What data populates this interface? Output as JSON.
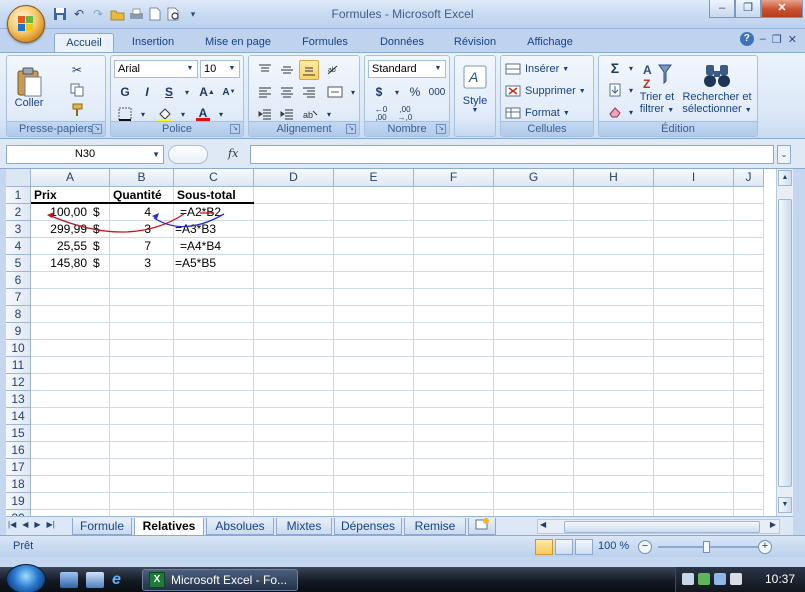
{
  "window": {
    "title": "Formules - Microsoft Excel"
  },
  "ribbon_tabs": [
    "Accueil",
    "Insertion",
    "Mise en page",
    "Formules",
    "Données",
    "Révision",
    "Affichage"
  ],
  "groups": {
    "clipboard": {
      "label": "Presse-papiers",
      "paste": "Coller"
    },
    "font": {
      "label": "Police",
      "font_name": "Arial",
      "font_size": "10",
      "bold": "G",
      "italic": "I",
      "underline": "S"
    },
    "alignment": {
      "label": "Alignement"
    },
    "number": {
      "label": "Nombre",
      "format": "Standard",
      "currency": "$",
      "percent": "%",
      "thousands": "000"
    },
    "style": {
      "label": "Style"
    },
    "cells": {
      "label": "Cellules",
      "insert": "Insérer",
      "delete": "Supprimer",
      "format": "Format"
    },
    "editing": {
      "label": "Édition",
      "sort": "Trier et",
      "sort2": "filtrer",
      "find": "Rechercher et",
      "find2": "sélectionner",
      "sigma": "Σ"
    }
  },
  "formula_bar": {
    "name_box": "N30",
    "fx": "fx",
    "content": ""
  },
  "grid": {
    "columns": [
      "A",
      "B",
      "C",
      "D",
      "E",
      "F",
      "G",
      "H",
      "I",
      "J"
    ],
    "rows": [
      "1",
      "2",
      "3",
      "4",
      "5",
      "6",
      "7",
      "8",
      "9",
      "10",
      "11",
      "12",
      "13",
      "14",
      "15",
      "16",
      "17",
      "18",
      "19",
      "20"
    ],
    "headers": {
      "a": "Prix",
      "b": "Quantité",
      "c": "Sous-total"
    },
    "data": [
      {
        "a": "100,00",
        "cur": "$",
        "b": "4",
        "c": "=A2*B2"
      },
      {
        "a": "299,99",
        "cur": "$",
        "b": "3",
        "c": "=A3*B3"
      },
      {
        "a": "25,55",
        "cur": "$",
        "b": "7",
        "c": "=A4*B4"
      },
      {
        "a": "145,80",
        "cur": "$",
        "b": "3",
        "c": "=A5*B5"
      }
    ]
  },
  "sheets": [
    "Formule",
    "Relatives",
    "Absolues",
    "Mixtes",
    "Dépenses",
    "Remise"
  ],
  "active_sheet": "Relatives",
  "status": {
    "text": "Prêt",
    "zoom": "100 %"
  },
  "taskbar": {
    "app": "Microsoft Excel - Fo...",
    "clock": "10:37"
  },
  "colors": {
    "accent": "#15428b",
    "ribbon_bg": "#dce8f7",
    "arrow_red": "#c0141c",
    "arrow_blue": "#2830c8"
  }
}
